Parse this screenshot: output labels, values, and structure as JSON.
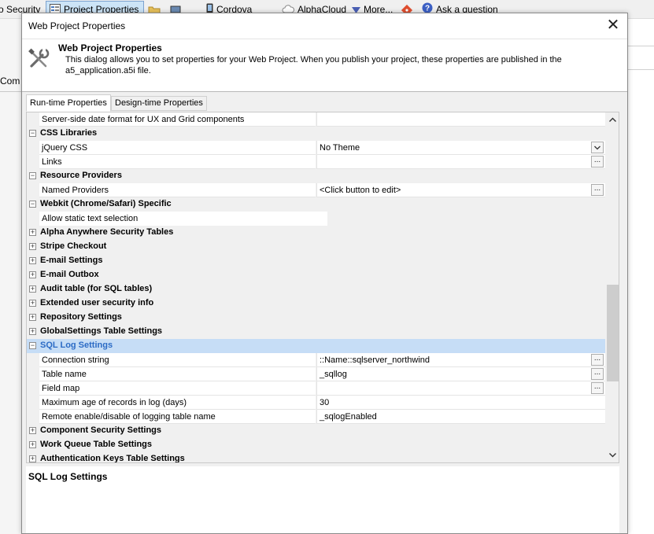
{
  "toolbar": {
    "security_label": "o Security",
    "project_properties_label": "Project Properties",
    "cordova_label": "Cordova",
    "alphacloud_label": "AlphaCloud",
    "more_label": "More...",
    "ask_label": "Ask a question"
  },
  "app": {
    "left_text": "Com"
  },
  "dialog": {
    "title": "Web Project Properties",
    "close_symbol": "✕",
    "header_title": "Web Project Properties",
    "header_description": "This dialog allows you to set properties for your Web Project. When you publish your project, these properties are published in the a5_application.a5i file."
  },
  "tabs": [
    {
      "label": "Run-time Properties",
      "active": true
    },
    {
      "label": "Design-time Properties",
      "active": false
    }
  ],
  "grid": {
    "rows": [
      {
        "kind": "prop",
        "label": "Server-side date format for UX and Grid components",
        "value": ""
      },
      {
        "kind": "cat",
        "label": "CSS Libraries",
        "expanded": true
      },
      {
        "kind": "prop",
        "label": "jQuery CSS",
        "value": "No Theme",
        "control": "dropdown"
      },
      {
        "kind": "prop",
        "label": "Links",
        "value": "",
        "control": "ellipsis"
      },
      {
        "kind": "cat",
        "label": "Resource Providers",
        "expanded": true
      },
      {
        "kind": "prop",
        "label": "Named Providers",
        "value": "<Click button to edit>",
        "control": "ellipsis"
      },
      {
        "kind": "cat",
        "label": "Webkit (Chrome/Safari) Specific",
        "expanded": true
      },
      {
        "kind": "prop-short",
        "label": "Allow static text selection",
        "value": ""
      },
      {
        "kind": "cat",
        "label": "Alpha Anywhere Security Tables",
        "expanded": false
      },
      {
        "kind": "cat",
        "label": "Stripe Checkout",
        "expanded": false
      },
      {
        "kind": "cat",
        "label": "E-mail Settings",
        "expanded": false
      },
      {
        "kind": "cat",
        "label": "E-mail Outbox",
        "expanded": false
      },
      {
        "kind": "cat",
        "label": "Audit table (for SQL tables)",
        "expanded": false
      },
      {
        "kind": "cat",
        "label": "Extended user security info",
        "expanded": false
      },
      {
        "kind": "cat",
        "label": "Repository Settings",
        "expanded": false
      },
      {
        "kind": "cat",
        "label": "GlobalSettings Table Settings",
        "expanded": false
      },
      {
        "kind": "cat",
        "label": "SQL Log Settings",
        "expanded": true,
        "selected": true
      },
      {
        "kind": "prop",
        "label": "Connection string",
        "value": "::Name::sqlserver_northwind",
        "control": "ellipsis"
      },
      {
        "kind": "prop",
        "label": "Table name",
        "value": "_sqllog",
        "control": "ellipsis"
      },
      {
        "kind": "prop",
        "label": "Field map",
        "value": "",
        "control": "ellipsis"
      },
      {
        "kind": "prop",
        "label": "Maximum age of records in log (days)",
        "value": "30"
      },
      {
        "kind": "prop",
        "label": "Remote enable/disable of logging table name",
        "value": "_sqlogEnabled"
      },
      {
        "kind": "cat",
        "label": "Component Security Settings",
        "expanded": false
      },
      {
        "kind": "cat",
        "label": "Work Queue Table Settings",
        "expanded": false
      },
      {
        "kind": "cat",
        "label": "Authentication Keys Table Settings",
        "expanded": false
      }
    ]
  },
  "description_panel": {
    "title": "SQL Log Settings"
  },
  "colors": {
    "selection": "#c6ddf6",
    "selected_text": "#2c6bc5"
  }
}
